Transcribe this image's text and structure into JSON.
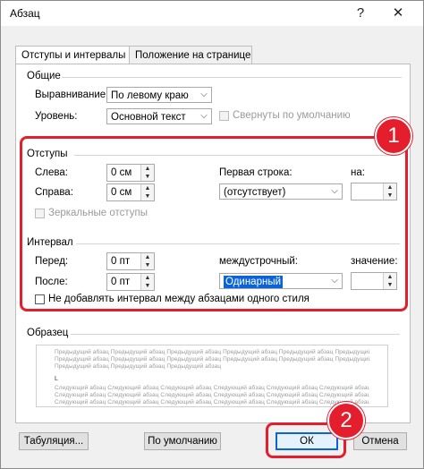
{
  "window": {
    "title": "Абзац",
    "help": "?",
    "close": "✕"
  },
  "tabs": [
    {
      "label": "Отступы и интервалы"
    },
    {
      "label": "Положение на странице"
    }
  ],
  "general": {
    "title": "Общие",
    "alignment_label": "Выравнивание:",
    "alignment_value": "По левому краю",
    "level_label": "Уровень:",
    "level_value": "Основной текст",
    "collapsed_label": "Свернуты по умолчанию"
  },
  "indent": {
    "title": "Отступы",
    "left_label": "Слева:",
    "left_value": "0 см",
    "right_label": "Справа:",
    "right_value": "0 см",
    "mirror_label": "Зеркальные отступы",
    "first_line_label": "Первая строка:",
    "first_line_value": "(отсутствует)",
    "by_label": "на:",
    "by_value": ""
  },
  "spacing": {
    "title": "Интервал",
    "before_label": "Перед:",
    "before_value": "0 пт",
    "after_label": "После:",
    "after_value": "0 пт",
    "line_label": "междустрочный:",
    "line_value": "Одинарный",
    "value_label": "значение:",
    "value_value": "",
    "no_space_label": "Не добавлять интервал между абзацами одного стиля"
  },
  "preview": {
    "title": "Образец",
    "prev_line": "Предыдущий абзац Предыдущий абзац Предыдущий абзац Предыдущий абзац Предыдущий абзац Предыдущий абзац Предыдущий абзац",
    "prev_line_short": "Предыдущий абзац Предыдущий абзац Предыдущий абзац",
    "sample_char": "L",
    "next_line": "Следующий абзац Следующий абзац Следующий абзац Следующий абзац Следующий абзац Следующий абзац Следующий абзац Следующий абзац"
  },
  "buttons": {
    "tabs": "Табуляция...",
    "default": "По умолчанию",
    "ok": "ОК",
    "cancel": "Отмена"
  },
  "annotations": {
    "badge1": "1",
    "badge2": "2"
  },
  "colors": {
    "highlight": "#e41e2d",
    "selection": "#0a64d8"
  }
}
